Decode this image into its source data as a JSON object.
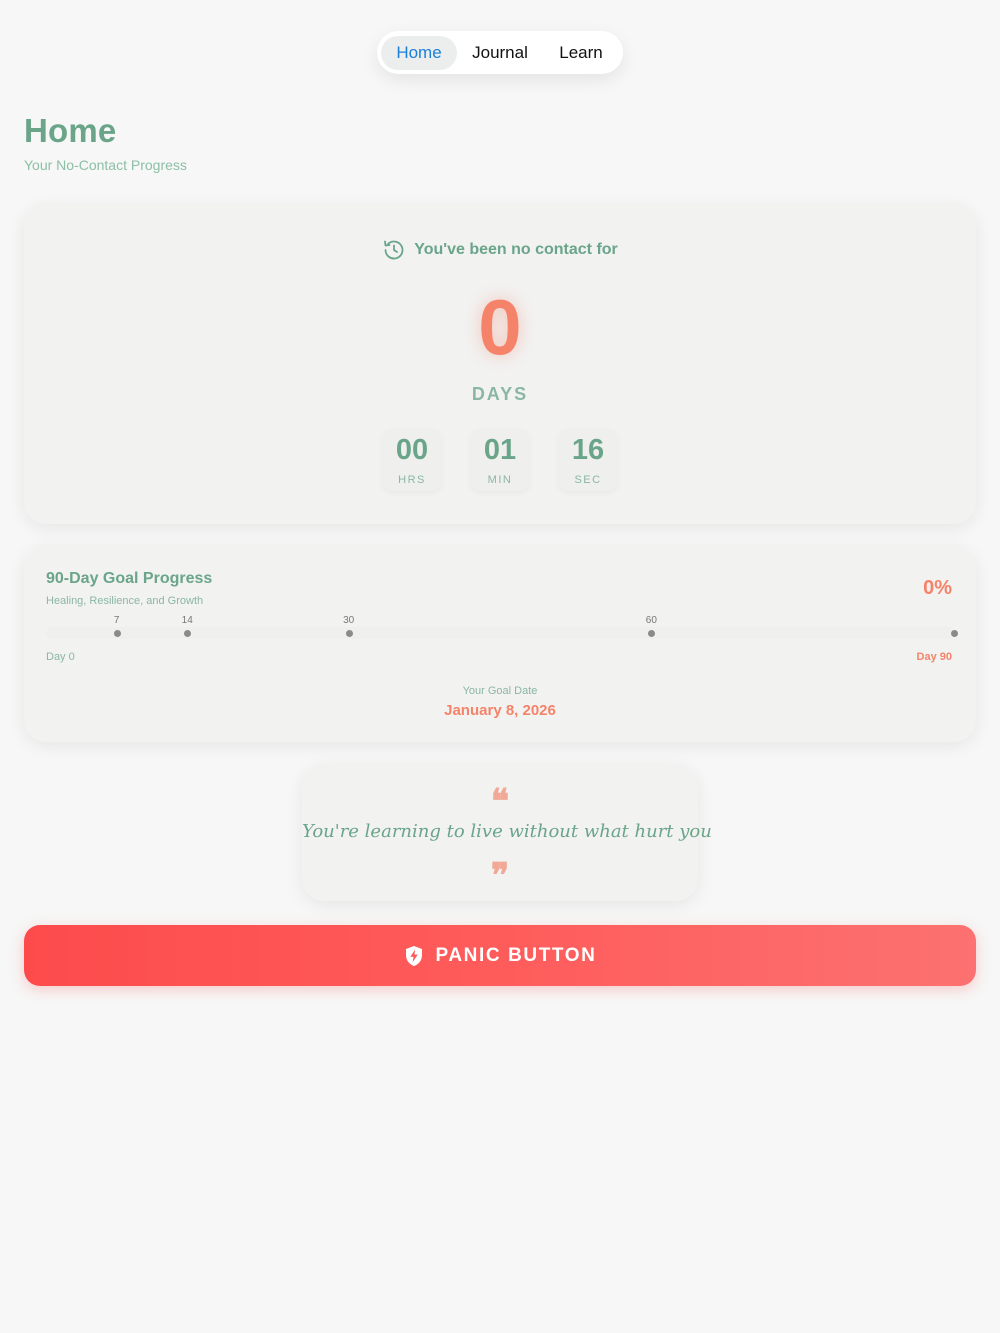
{
  "nav": {
    "tabs": [
      {
        "label": "Home",
        "active": true
      },
      {
        "label": "Journal",
        "active": false
      },
      {
        "label": "Learn",
        "active": false
      }
    ]
  },
  "header": {
    "title": "Home",
    "subtitle": "Your No-Contact Progress"
  },
  "timer": {
    "heading": "You've been no contact for",
    "heading_icon": "history-icon",
    "days_value": "0",
    "days_label": "DAYS",
    "units": [
      {
        "value": "00",
        "label": "HRS"
      },
      {
        "value": "01",
        "label": "MIN"
      },
      {
        "value": "16",
        "label": "SEC"
      }
    ]
  },
  "goal": {
    "title": "90-Day Goal Progress",
    "subtitle": "Healing, Resilience, and Growth",
    "percent_label": "0%",
    "progress_fraction": 0,
    "total_days": 90,
    "milestones": [
      7,
      14,
      30,
      60,
      90
    ],
    "milestone_labels": [
      "7",
      "14",
      "30",
      "60",
      ""
    ],
    "start_label": "Day 0",
    "end_label": "Day 90",
    "goal_date_label": "Your Goal Date",
    "goal_date": "January 8, 2026"
  },
  "quote": {
    "open_mark": "❝",
    "text": "You're learning to live without what hurt you",
    "close_mark": "❞"
  },
  "panic": {
    "label": "PANIC BUTTON",
    "icon": "shield-bolt-icon"
  },
  "colors": {
    "accent_green": "#6aa58a",
    "accent_coral": "#f5836a",
    "panic_red": "#fd4b4c",
    "nav_active_blue": "#1a7fd9"
  }
}
